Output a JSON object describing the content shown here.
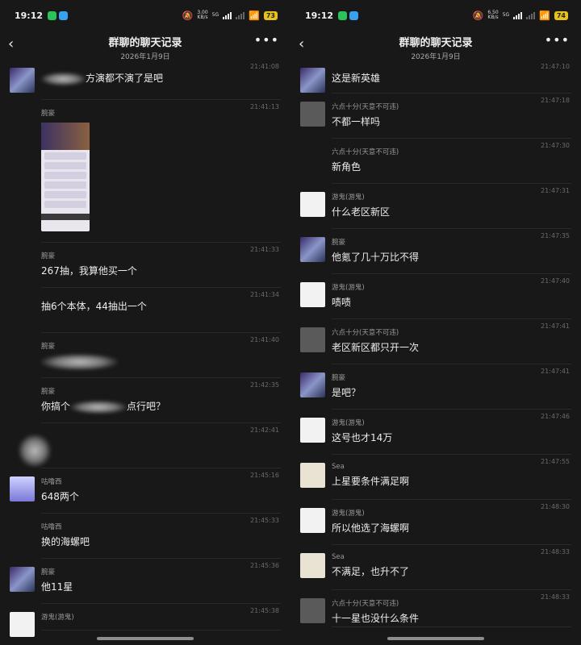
{
  "status": {
    "time": "19:12",
    "net_speed_left": "3.00\nKB/s",
    "net_speed_right": "6.50\nKB/s",
    "battery_left": "73",
    "battery_right": "74",
    "net_label": "5G"
  },
  "header": {
    "title": "群聊的聊天记录",
    "subtitle": "2026年1月9日"
  },
  "left_messages": [
    {
      "name": "",
      "time": "21:41:08",
      "text": "方演都不演了是吧",
      "avatar": "hero"
    },
    {
      "name": "腕豪",
      "time": "21:41:13",
      "text": "",
      "avatar": "none"
    },
    {
      "name": "腕豪",
      "time": "21:41:33",
      "text": "267抽，我算他买一个",
      "avatar": "none"
    },
    {
      "name": "",
      "time": "21:41:34",
      "text": "抽6个本体，44抽出一个",
      "avatar": "none"
    },
    {
      "name": "腕豪",
      "time": "21:41:40",
      "text": "",
      "avatar": "none"
    },
    {
      "name": "腕豪",
      "time": "21:42:35",
      "text": "你搞个",
      "text2": "点行吧？",
      "avatar": "none"
    },
    {
      "name": "",
      "time": "21:42:41",
      "text": "",
      "avatar": "none"
    },
    {
      "name": "咕噜西",
      "time": "21:45:16",
      "text": "648两个",
      "avatar": "anime"
    },
    {
      "name": "咕噜西",
      "time": "21:45:33",
      "text": "换的海螺吧",
      "avatar": "none"
    },
    {
      "name": "腕豪",
      "time": "21:45:36",
      "text": "他11星",
      "avatar": "hero"
    },
    {
      "name": "游鬼(游鬼)",
      "time": "21:45:38",
      "text": "",
      "avatar": "hair"
    }
  ],
  "right_messages": [
    {
      "name": "",
      "time": "21:47:10",
      "text": "这是新英雄",
      "avatar": "hero"
    },
    {
      "name": "六点十分(天意不可违)",
      "time": "21:47:18",
      "text": "不都一样吗",
      "avatar": "runner"
    },
    {
      "name": "六点十分(天意不可违)",
      "time": "21:47:30",
      "text": "新角色",
      "avatar": "none"
    },
    {
      "name": "游鬼(游鬼)",
      "time": "21:47:31",
      "text": "什么老区新区",
      "avatar": "hair"
    },
    {
      "name": "腕豪",
      "time": "21:47:35",
      "text": "他氪了几十万比不得",
      "avatar": "hero"
    },
    {
      "name": "游鬼(游鬼)",
      "time": "21:47:40",
      "text": "啧啧",
      "avatar": "hair"
    },
    {
      "name": "六点十分(天意不可违)",
      "time": "21:47:41",
      "text": "老区新区都只开一次",
      "avatar": "runner"
    },
    {
      "name": "腕豪",
      "time": "21:47:41",
      "text": "是吧？",
      "avatar": "hero"
    },
    {
      "name": "游鬼(游鬼)",
      "time": "21:47:46",
      "text": "这号也才14万",
      "avatar": "hair"
    },
    {
      "name": "Sea",
      "time": "21:47:55",
      "text": "上星要条件满足啊",
      "avatar": "bunny"
    },
    {
      "name": "游鬼(游鬼)",
      "time": "21:48:30",
      "text": "所以他选了海螺啊",
      "avatar": "hair"
    },
    {
      "name": "Sea",
      "time": "21:48:33",
      "text": "不满足，也升不了",
      "avatar": "bunny"
    },
    {
      "name": "六点十分(天意不可违)",
      "time": "21:48:33",
      "text": "十一星也没什么条件",
      "avatar": "runner"
    }
  ]
}
